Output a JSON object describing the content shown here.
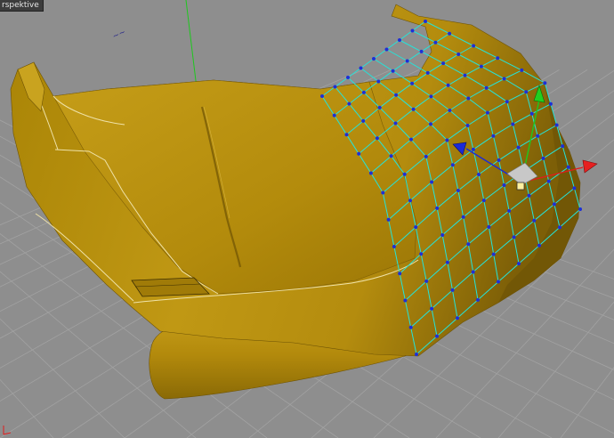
{
  "viewport": {
    "label": "rspektive",
    "colors": {
      "background": "#8e8e8e",
      "grid": "#a2a2a2",
      "surface": "#b8900f",
      "surface_dark": "#7d5f07",
      "wireframe": "#25e3d9",
      "vertex": "#1d2fd8",
      "axis_x": "#e01c1c",
      "axis_y": "#1ec81e",
      "axis_z": "#1b2ad8"
    },
    "icons": [
      "axis-gizmo-icon",
      "world-axis-icon"
    ]
  }
}
